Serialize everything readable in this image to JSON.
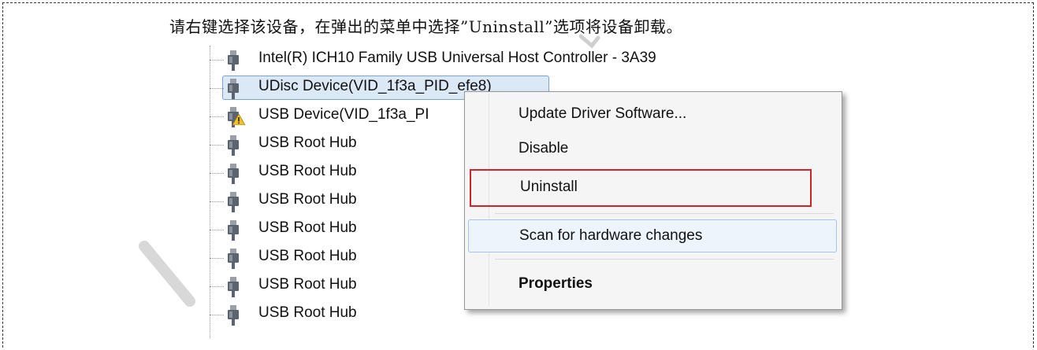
{
  "instruction": "请右键选择该设备，在弹出的菜单中选择”Uninstall”选项将设备卸载。",
  "tree": {
    "items": [
      {
        "label": "Intel(R) ICH10 Family USB Universal Host Controller - 3A39",
        "icon": "usb-plug-icon"
      },
      {
        "label": "UDisc Device(VID_1f3a_PID_efe8)",
        "icon": "usb-plug-icon",
        "selected": true
      },
      {
        "label": "USB Device(VID_1f3a_PI",
        "icon": "usb-plug-icon",
        "warning": true
      },
      {
        "label": "USB Root Hub",
        "icon": "usb-plug-icon"
      },
      {
        "label": "USB Root Hub",
        "icon": "usb-plug-icon"
      },
      {
        "label": "USB Root Hub",
        "icon": "usb-plug-icon"
      },
      {
        "label": "USB Root Hub",
        "icon": "usb-plug-icon"
      },
      {
        "label": "USB Root Hub",
        "icon": "usb-plug-icon"
      },
      {
        "label": "USB Root Hub",
        "icon": "usb-plug-icon"
      },
      {
        "label": "USB Root Hub",
        "icon": "usb-plug-icon"
      }
    ]
  },
  "context_menu": {
    "items": [
      {
        "label": "Update Driver Software..."
      },
      {
        "label": "Disable"
      },
      {
        "label": "Uninstall",
        "highlighted": true
      },
      {
        "label": "Scan for hardware changes",
        "hover": true
      },
      {
        "label": "Properties",
        "bold": true
      }
    ]
  },
  "colors": {
    "selection_bg": "#dbe8f6",
    "selection_border": "#7da2ce",
    "highlight_outline": "#d2232a",
    "menu_bg": "#f5f5f5"
  }
}
